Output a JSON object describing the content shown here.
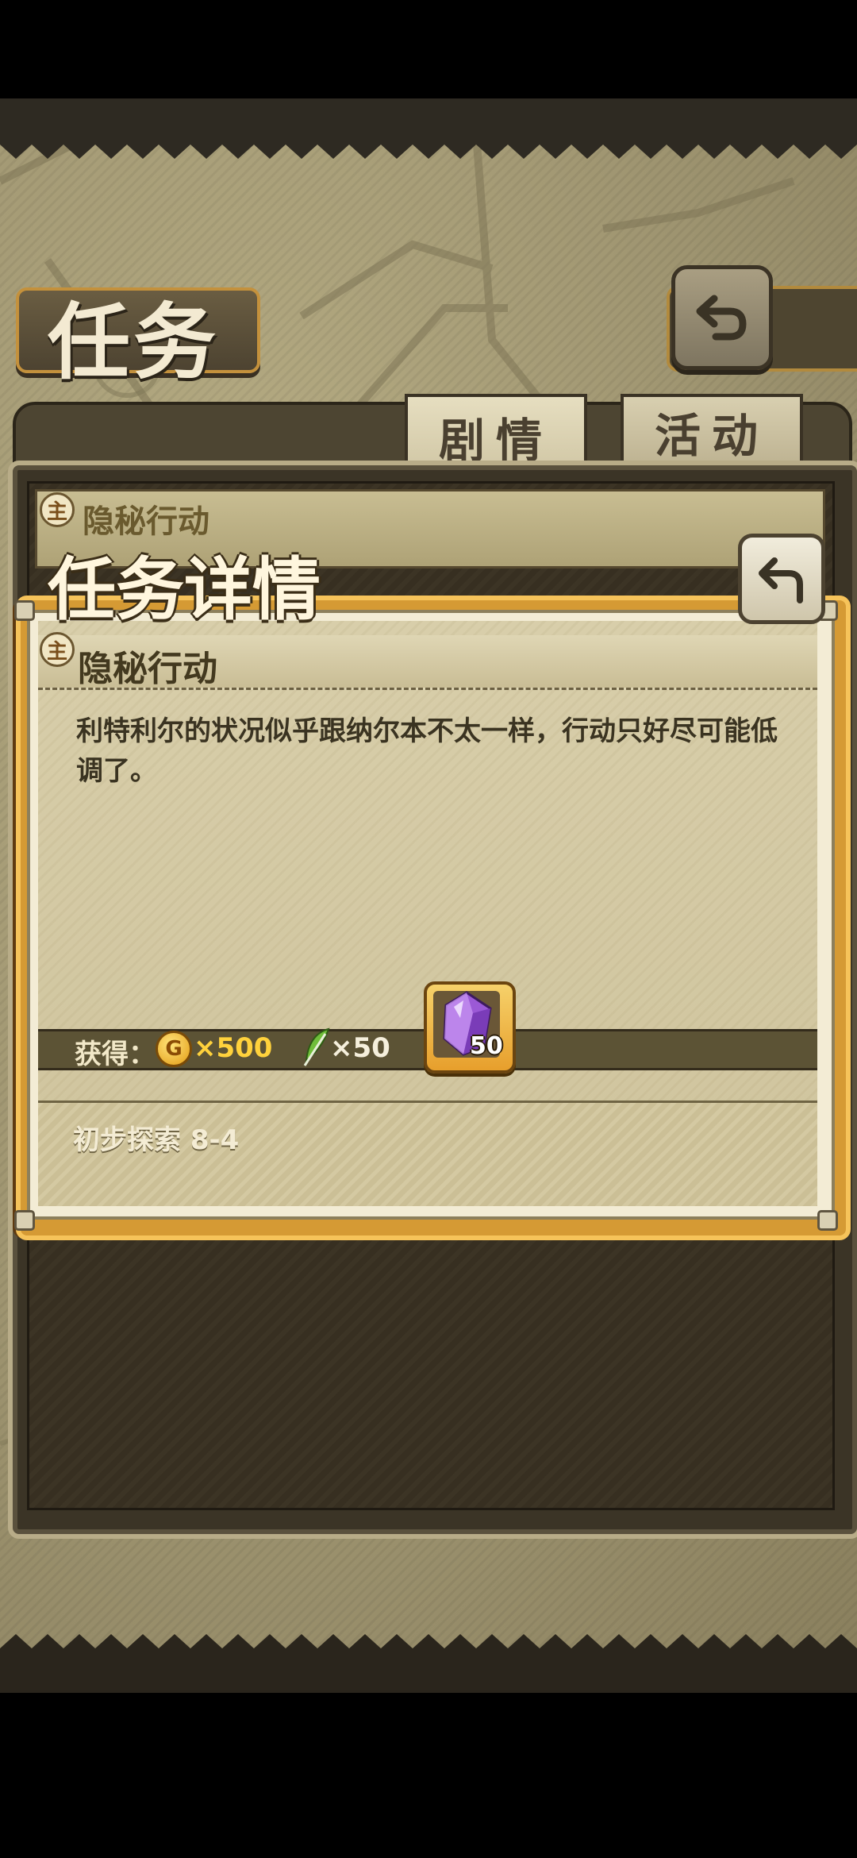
{
  "header": {
    "title": "任务",
    "back_icon": "undo-arrow-icon"
  },
  "tabs": [
    {
      "label": "剧情",
      "selected": true
    },
    {
      "label": "活动",
      "selected": false
    }
  ],
  "quest_list": {
    "items": [
      {
        "badge": "主",
        "title": "隐秘行动"
      }
    ]
  },
  "detail": {
    "header": "任务详情",
    "badge": "主",
    "quest_title": "隐秘行动",
    "description": "利特利尔的状况似乎跟纳尔本不太一样，行动只好尽可能低调了。",
    "rewards": {
      "label": "获得：",
      "coin_icon_letter": "G",
      "coin_amount": "×500",
      "feather_amount": "×50",
      "gem_count": "50"
    },
    "requirement": "初步探索 8-4"
  },
  "colors": {
    "frame_orange": "#d59a34",
    "coin_text": "#ffd23c",
    "gem": "#9b59d6"
  }
}
